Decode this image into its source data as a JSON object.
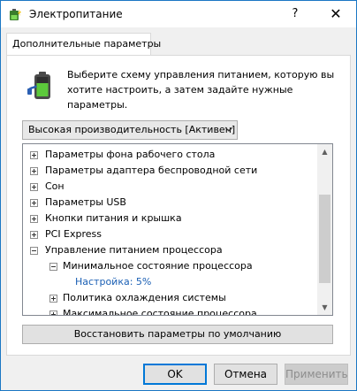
{
  "window": {
    "title": "Электропитание",
    "help_label": "?",
    "close_label": "✕"
  },
  "tab": {
    "label": "Дополнительные параметры"
  },
  "intro": {
    "text": "Выберите схему управления питанием, которую вы хотите настроить, а затем задайте нужные параметры."
  },
  "scheme_select": {
    "value": "Высокая производительность [Активен]"
  },
  "tree": {
    "items": [
      {
        "label": "Параметры фона рабочего стола",
        "expander": "plus"
      },
      {
        "label": "Параметры адаптера беспроводной сети",
        "expander": "plus"
      },
      {
        "label": "Сон",
        "expander": "plus"
      },
      {
        "label": "Параметры USB",
        "expander": "plus"
      },
      {
        "label": "Кнопки питания и крышка",
        "expander": "plus"
      },
      {
        "label": "PCI Express",
        "expander": "plus"
      },
      {
        "label": "Управление питанием процессора",
        "expander": "minus"
      },
      {
        "label": "Минимальное состояние процессора",
        "expander": "minus"
      },
      {
        "label": "Настройка: 5%"
      },
      {
        "label": "Политика охлаждения системы",
        "expander": "plus"
      },
      {
        "label": "Максимальное состояние процессора",
        "expander": "plus"
      }
    ]
  },
  "restore_button": {
    "label": "Восстановить параметры по умолчанию"
  },
  "footer": {
    "ok_label": "OK",
    "cancel_label": "Отмена",
    "apply_label": "Применить"
  },
  "colors": {
    "accent": "#0078d7",
    "link": "#1a5fb4",
    "window_bg": "#f0f0f0"
  }
}
